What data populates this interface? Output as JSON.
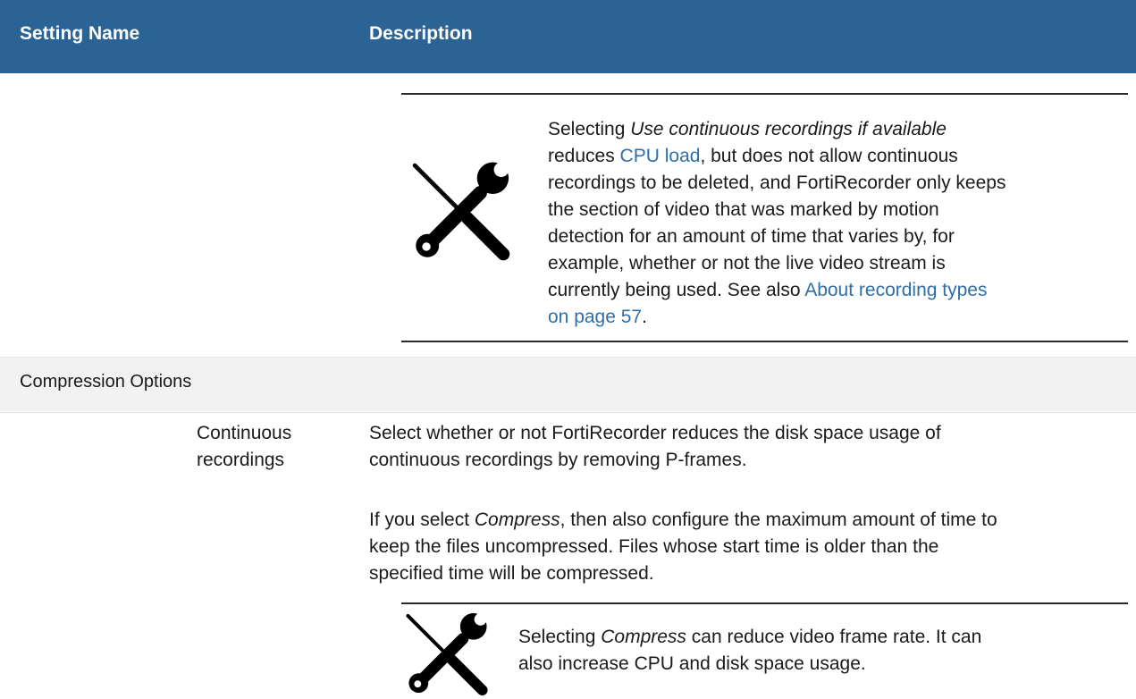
{
  "header": {
    "setting_name": "Setting Name",
    "description": "Description"
  },
  "note1": {
    "line1_em": "Use continuous recordings if available",
    "line1_prefix": "Selecting ",
    "line2_prefix": "reduces ",
    "line2_link": "CPU load",
    "line2_suffix": ", but does not allow continuous",
    "line3": "recordings to be deleted, and FortiRecorder only keeps",
    "line4": "the section of video that was marked by motion",
    "line5": "detection for an amount of time that varies by, for",
    "line6": "example, whether or not the live video stream is",
    "line7_prefix": "currently being used. See also ",
    "line7_link": "About recording types",
    "line8_link": "on page 57",
    "line8_suffix": "."
  },
  "section": {
    "title": "Compression Options"
  },
  "setting": {
    "line1": "Continuous",
    "line2": "recordings"
  },
  "description": {
    "p1_line1": "Select whether or not FortiRecorder reduces the disk space usage of",
    "p1_line2": "continuous recordings by removing P-frames.",
    "p2_line1_prefix": "If you select ",
    "p2_line1_em": "Compress",
    "p2_line1_suffix": ", then also configure the maximum amount of time to",
    "p2_line2": "keep the files uncompressed. Files whose start time is older than the",
    "p2_line3": "specified time will be compressed."
  },
  "note2": {
    "line1_prefix": "Selecting ",
    "line1_em": "Compress",
    "line1_suffix": " can reduce video frame rate. It can",
    "line2": "also increase CPU and disk space usage."
  },
  "icons": {
    "note_icon": "tools-icon",
    "color": "#000000"
  },
  "colors": {
    "header_bg": "#2b6395",
    "link": "#2f6fa6",
    "section_bg": "#f2f2f2"
  }
}
